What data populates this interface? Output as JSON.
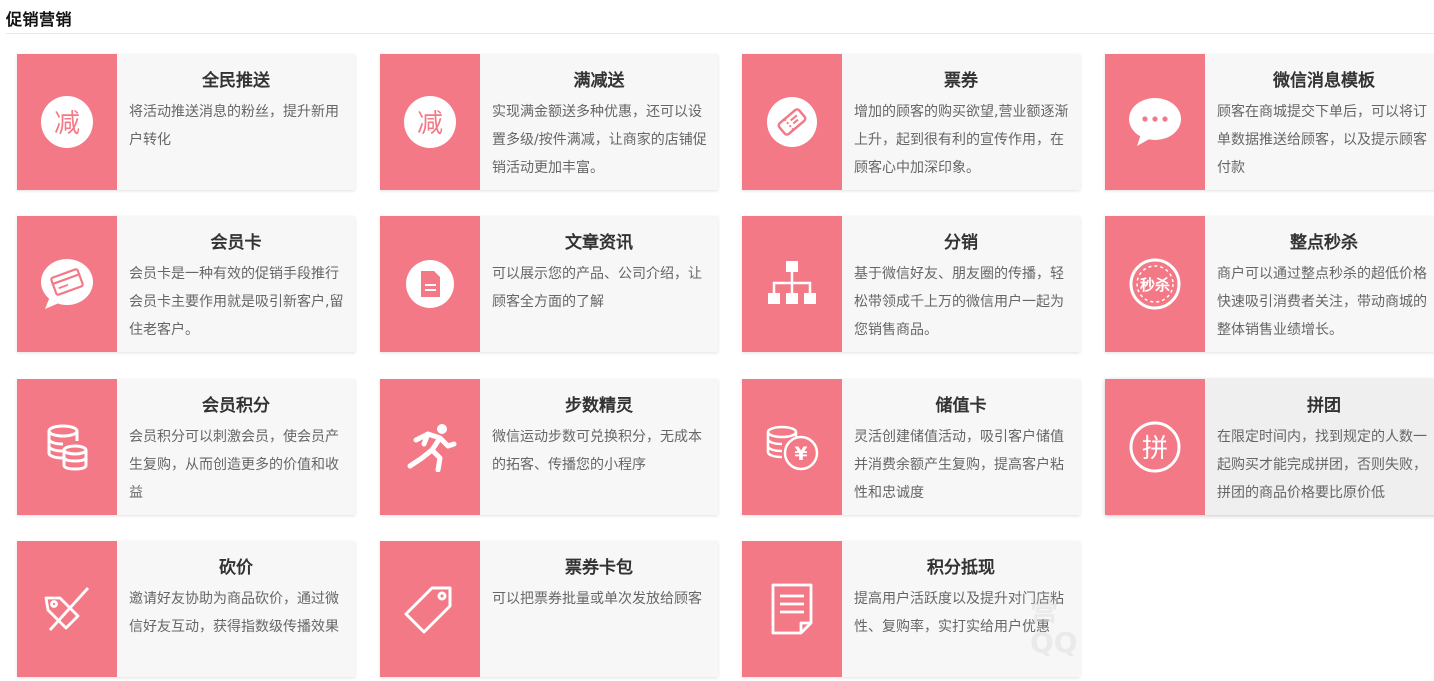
{
  "page": {
    "title": "促销营销"
  },
  "colors": {
    "accent": "#f47986",
    "card_bg": "#f7f7f7"
  },
  "cards": [
    {
      "icon": "reduce-icon",
      "glyph": "减",
      "title": "全民推送",
      "desc": "将活动推送消息的粉丝，提升新用户转化"
    },
    {
      "icon": "reduce-icon",
      "glyph": "减",
      "title": "满减送",
      "desc": "实现满金额送多种优惠，还可以设置多级/按件满减，让商家的店铺促销活动更加丰富。"
    },
    {
      "icon": "ticket-icon",
      "title": "票券",
      "desc": "增加的顾客的购买欲望,营业额逐渐上升，起到很有利的宣传作用，在顾客心中加深印象。"
    },
    {
      "icon": "chat-bubble-icon",
      "title": "微信消息模板",
      "desc": "顾客在商城提交下单后，可以将订单数据推送给顾客，以及提示顾客付款"
    },
    {
      "icon": "member-card-icon",
      "title": "会员卡",
      "desc": "会员卡是一种有效的促销手段推行会员卡主要作用就是吸引新客户,留住老客户。"
    },
    {
      "icon": "document-icon",
      "title": "文章资讯",
      "desc": "可以展示您的产品、公司介绍，让顾客全方面的了解"
    },
    {
      "icon": "hierarchy-icon",
      "title": "分销",
      "desc": "基于微信好友、朋友圈的传播，轻松带领成千上万的微信用户一起为您销售商品。"
    },
    {
      "icon": "flash-sale-icon",
      "glyph": "秒杀",
      "title": "整点秒杀",
      "desc": "商户可以通过整点秒杀的超低价格快速吸引消费者关注，带动商城的整体销售业绩增长。"
    },
    {
      "icon": "database-icon",
      "title": "会员积分",
      "desc": "会员积分可以刺激会员，使会员产生复购，从而创造更多的价值和收益"
    },
    {
      "icon": "runner-icon",
      "title": "步数精灵",
      "desc": "微信运动步数可兑换积分，无成本的拓客、传播您的小程序"
    },
    {
      "icon": "coin-yen-icon",
      "glyph": "¥",
      "title": "储值卡",
      "desc": "灵活创建储值活动，吸引客户储值并消费余额产生复购，提高客户粘性和忠诚度"
    },
    {
      "icon": "group-buy-icon",
      "glyph": "拼",
      "title": "拼团",
      "desc": "在限定时间内，找到规定的人数一起购买才能完成拼团，否则失败，拼团的商品价格要比原价低"
    },
    {
      "icon": "price-cut-icon",
      "title": "砍价",
      "desc": "邀请好友协助为商品砍价，通过微信好友互动，获得指数级传播效果"
    },
    {
      "icon": "tag-icon",
      "title": "票券卡包",
      "desc": "可以把票券批量或单次发放给顾客"
    },
    {
      "icon": "receipt-icon",
      "title": "积分抵现",
      "desc": "提高用户活跃度以及提升对门店粘性、复购率，实打实给用户优惠"
    }
  ]
}
